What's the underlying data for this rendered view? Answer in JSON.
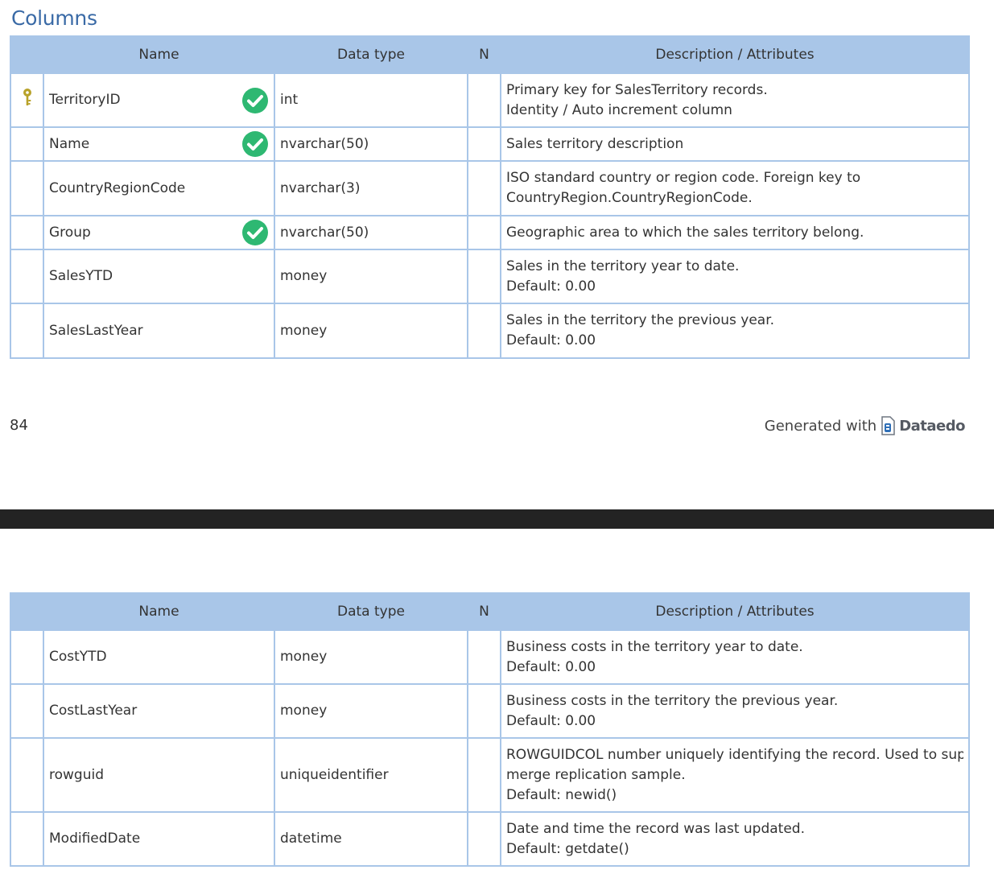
{
  "section_title": "Columns",
  "headers": {
    "name": "Name",
    "data_type": "Data type",
    "nullable": "N",
    "description": "Description / Attributes"
  },
  "table1": [
    {
      "name": "TerritoryID",
      "type": "int",
      "pk": true,
      "unique": true,
      "desc1": "Primary key for SalesTerritory records.",
      "desc2": "Identity / Auto increment column",
      "desc3": ""
    },
    {
      "name": "Name",
      "type": "nvarchar(50)",
      "pk": false,
      "unique": true,
      "desc1": "Sales territory description",
      "desc2": "",
      "desc3": ""
    },
    {
      "name": "CountryRegionCode",
      "type": "nvarchar(3)",
      "pk": false,
      "unique": false,
      "desc1": "ISO standard country or region code. Foreign key to",
      "desc2": "CountryRegion.CountryRegionCode.",
      "desc3": ""
    },
    {
      "name": "Group",
      "type": "nvarchar(50)",
      "pk": false,
      "unique": true,
      "desc1": "Geographic area to which the sales territory belong.",
      "desc2": "",
      "desc3": ""
    },
    {
      "name": "SalesYTD",
      "type": "money",
      "pk": false,
      "unique": false,
      "desc1": "Sales in the territory year to date.",
      "desc2": "Default: 0.00",
      "desc3": ""
    },
    {
      "name": "SalesLastYear",
      "type": "money",
      "pk": false,
      "unique": false,
      "desc1": "Sales in the territory the previous year.",
      "desc2": "Default: 0.00",
      "desc3": ""
    }
  ],
  "table2": [
    {
      "name": "CostYTD",
      "type": "money",
      "desc1": "Business costs in the territory year to date.",
      "desc2": "Default: 0.00",
      "desc3": ""
    },
    {
      "name": "CostLastYear",
      "type": "money",
      "desc1": "Business costs in the territory the previous year.",
      "desc2": "Default: 0.00",
      "desc3": ""
    },
    {
      "name": "rowguid",
      "type": "uniqueidentifier",
      "desc1": "ROWGUIDCOL number uniquely identifying the record. Used to support a",
      "desc2": "merge replication sample.",
      "desc3": "Default: newid()"
    },
    {
      "name": "ModifiedDate",
      "type": "datetime",
      "desc1": "Date and time the record was last updated.",
      "desc2": "Default: getdate()",
      "desc3": ""
    }
  ],
  "footer": {
    "page_number": "84",
    "generated_with": "Generated with",
    "brand": "Dataedo"
  },
  "colors": {
    "header_bg": "#a9c6e8",
    "border": "#a9c6e8",
    "title": "#3a6aa6",
    "check_green": "#2eb872",
    "key_gold": "#b8a22a",
    "page_break": "#232323"
  },
  "icons": {
    "primary_key": "key-icon",
    "unique": "check-circle-icon",
    "brand_logo": "dataedo-logo-icon"
  }
}
